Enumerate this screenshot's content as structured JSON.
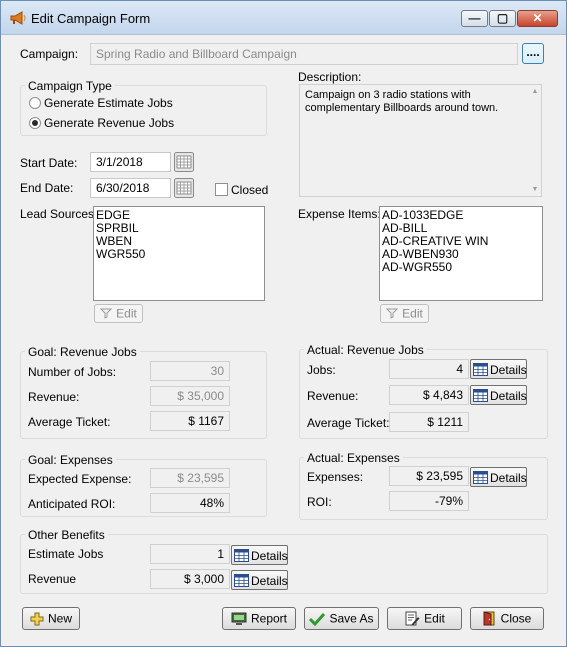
{
  "window": {
    "title": "Edit Campaign Form",
    "minimize_glyph": "—",
    "maximize_glyph": "▢",
    "close_glyph": "✕"
  },
  "campaign": {
    "label": "Campaign:",
    "value": "Spring Radio and Billboard Campaign",
    "browse_label": "...."
  },
  "campaign_type": {
    "title": "Campaign Type",
    "options": [
      "Generate Estimate Jobs",
      "Generate Revenue Jobs"
    ],
    "selected": "Generate Revenue Jobs"
  },
  "description": {
    "label": "Description:",
    "text": "Campaign on 3 radio stations with complementary Billboards around town."
  },
  "dates": {
    "start_label": "Start Date:",
    "start_value": "3/1/2018",
    "end_label": "End Date:",
    "end_value": "6/30/2018",
    "closed_label": "Closed",
    "closed_checked": false
  },
  "lead_sources": {
    "label": "Lead Sources:",
    "items": [
      "EDGE",
      "SPRBIL",
      "WBEN",
      "WGR550"
    ],
    "edit_label": "Edit"
  },
  "expense_items": {
    "label": "Expense Items:",
    "items": [
      "AD-1033EDGE",
      "AD-BILL",
      "AD-CREATIVE WIN",
      "AD-WBEN930",
      "AD-WGR550"
    ],
    "edit_label": "Edit"
  },
  "goal_revenue": {
    "title": "Goal: Revenue Jobs",
    "jobs_label": "Number of Jobs:",
    "jobs_value": "30",
    "revenue_label": "Revenue:",
    "revenue_value": "$ 35,000",
    "avg_label": "Average Ticket:",
    "avg_value": "$ 1167"
  },
  "actual_revenue": {
    "title": "Actual: Revenue Jobs",
    "jobs_label": "Jobs:",
    "jobs_value": "4",
    "revenue_label": "Revenue:",
    "revenue_value": "$ 4,843",
    "avg_label": "Average Ticket:",
    "avg_value": "$ 1211",
    "details_label": "Details"
  },
  "goal_expenses": {
    "title": "Goal: Expenses",
    "expense_label": "Expected Expense:",
    "expense_value": "$ 23,595",
    "roi_label": "Anticipated ROI:",
    "roi_value": "48%"
  },
  "actual_expenses": {
    "title": "Actual: Expenses",
    "expenses_label": "Expenses:",
    "expenses_value": "$ 23,595",
    "roi_label": "ROI:",
    "roi_value": "-79%",
    "details_label": "Details"
  },
  "other_benefits": {
    "title": "Other Benefits",
    "estimate_label": "Estimate Jobs",
    "estimate_value": "1",
    "revenue_label": "Revenue",
    "revenue_value": "$ 3,000",
    "details_label": "Details"
  },
  "footer": {
    "new_label": "New",
    "report_label": "Report",
    "save_as_label": "Save As",
    "edit_label": "Edit",
    "close_label": "Close"
  }
}
